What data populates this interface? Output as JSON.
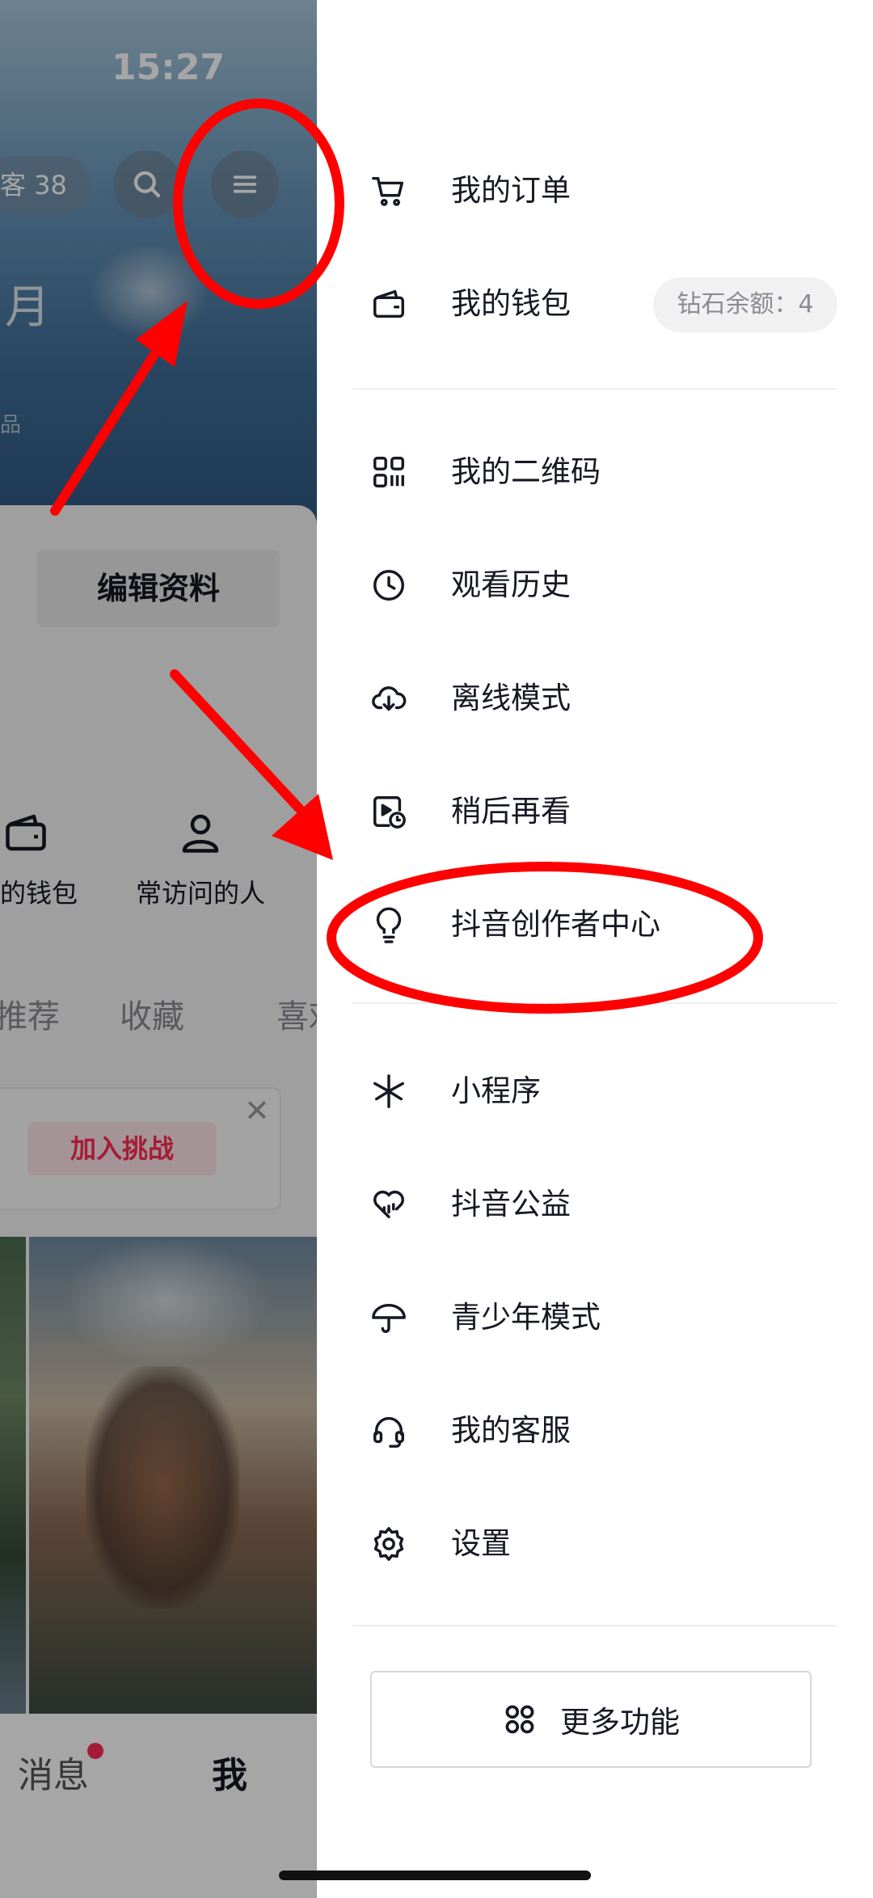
{
  "status_bar": {
    "time": "15:27"
  },
  "profile": {
    "visitor_pill": "客 38",
    "cover_text": "月",
    "cover_small_text": "品",
    "edit_profile_label": "编辑资料",
    "shortcuts": [
      {
        "label": "我的钱包",
        "icon": "wallet-icon"
      },
      {
        "label": "常访问的人",
        "icon": "person-icon"
      }
    ],
    "tabs": [
      "推荐",
      "收藏",
      "喜欢"
    ],
    "challenge_button_label": "加入挑战",
    "challenge_close": "✕",
    "bottom_nav": {
      "messages_label": "消息",
      "me_label": "我"
    }
  },
  "drawer": {
    "group1": [
      {
        "label": "我的订单",
        "icon": "cart-icon"
      },
      {
        "label": "我的钱包",
        "icon": "wallet-icon"
      }
    ],
    "diamond_badge": "钻石余额：4",
    "group2": [
      {
        "label": "我的二维码",
        "icon": "qr-code-icon"
      },
      {
        "label": "观看历史",
        "icon": "clock-icon"
      },
      {
        "label": "离线模式",
        "icon": "cloud-download-icon"
      },
      {
        "label": "稍后再看",
        "icon": "watch-later-icon"
      },
      {
        "label": "抖音创作者中心",
        "icon": "lightbulb-icon"
      }
    ],
    "group3": [
      {
        "label": "小程序",
        "icon": "mini-program-icon"
      },
      {
        "label": "抖音公益",
        "icon": "charity-heart-icon"
      },
      {
        "label": "青少年模式",
        "icon": "umbrella-icon"
      },
      {
        "label": "我的客服",
        "icon": "headset-icon"
      },
      {
        "label": "设置",
        "icon": "gear-icon"
      }
    ],
    "more_features_label": "更多功能"
  },
  "colors": {
    "annotation_red": "#ff0000",
    "accent": "#fe2c55",
    "text_primary": "#161823",
    "text_secondary": "#8a8b91"
  }
}
